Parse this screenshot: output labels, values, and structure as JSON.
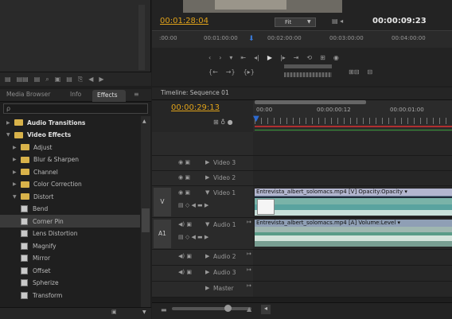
{
  "project_toolbar": [
    "▤",
    "▤▤",
    "▤",
    "⌕",
    "▣",
    "▤",
    "⎘",
    "◀",
    "▶"
  ],
  "monitor": {
    "timecode_left": "00:01:28:04",
    "fit": "Fit",
    "timecode_right": "00:00:09:23",
    "ruler": [
      ":00:00",
      "00:01:00:00",
      "00:02:00:00",
      "00:03:00:00",
      "00:04:00:00"
    ]
  },
  "panel_tabs": {
    "media_browser": "Media Browser",
    "info": "Info",
    "effects": "Effects"
  },
  "search_icon": "ρ",
  "effects": [
    {
      "label": "Audio Transitions",
      "kind": "folder",
      "bold": true,
      "open": false
    },
    {
      "label": "Video Effects",
      "kind": "folder",
      "bold": true,
      "open": true
    },
    {
      "label": "Adjust",
      "kind": "folder",
      "bold": false,
      "open": false
    },
    {
      "label": "Blur & Sharpen",
      "kind": "folder",
      "bold": false,
      "open": false
    },
    {
      "label": "Channel",
      "kind": "folder",
      "bold": false,
      "open": false
    },
    {
      "label": "Color Correction",
      "kind": "folder",
      "bold": false,
      "open": false
    },
    {
      "label": "Distort",
      "kind": "folder",
      "bold": false,
      "open": true
    },
    {
      "label": "Bend",
      "kind": "effect"
    },
    {
      "label": "Corner Pin",
      "kind": "effect",
      "selected": true
    },
    {
      "label": "Lens Distortion",
      "kind": "effect"
    },
    {
      "label": "Magnify",
      "kind": "effect"
    },
    {
      "label": "Mirror",
      "kind": "effect"
    },
    {
      "label": "Offset",
      "kind": "effect"
    },
    {
      "label": "Spherize",
      "kind": "effect"
    },
    {
      "label": "Transform",
      "kind": "effect"
    }
  ],
  "timeline": {
    "tab": "Timeline: Sequence 01",
    "timecode": "00:00:29:13",
    "ruler": [
      "00:00",
      "00:00:00:12",
      "00:00:01:00"
    ],
    "tracks": [
      {
        "name": "Video 3",
        "type": "video"
      },
      {
        "name": "Video 2",
        "type": "video"
      },
      {
        "name": "Video 1",
        "type": "video",
        "src": "V"
      },
      {
        "name": "Audio 1",
        "type": "audio",
        "src": "A1"
      },
      {
        "name": "Audio 2",
        "type": "audio"
      },
      {
        "name": "Audio 3",
        "type": "audio"
      },
      {
        "name": "Master",
        "type": "master"
      }
    ],
    "clips": {
      "video": "Entrevista_albert_solomacs.mp4 [V]  Opacity:Opacity ▾",
      "audio": "Entrevista_albert_solomacs.mp4 [A]  Volume:Level ▾"
    }
  },
  "colors": {
    "timecode": "#e0a21a",
    "folder": "#d8b24a",
    "playhead": "#2d6ad0"
  }
}
